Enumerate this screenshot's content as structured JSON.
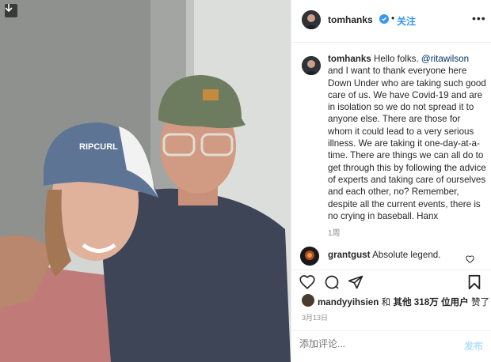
{
  "post": {
    "author": "tomhanks",
    "separator": "•",
    "follow_label": "关注",
    "more_label": "•••",
    "caption_author": "tomhanks",
    "caption_parts": {
      "before_mention": "Hello folks. ",
      "mention": "@ritawilson",
      "after_mention": " and I want to thank everyone here Down Under who are taking such good care of us. We have Covid-19 and are in isolation so we do not spread it to anyone else. There are those for whom it could lead to a very serious illness. We are taking it one-day-at-a-time. There are things we can all do to get through this by following the advice of experts and taking care of ourselves and each other, no? Remember, despite all the current events, there is no crying in baseball. Hanx"
    },
    "caption_time": "1周",
    "comment": {
      "author": "grantgust",
      "text": "Absolute legend."
    },
    "likes": {
      "user": "mandyyihsien",
      "connector": "和 ",
      "others": "其他 318万 位用户",
      "suffix": "赞了"
    },
    "date": "3月13日",
    "composer": {
      "placeholder": "添加评论...",
      "post_label": "发布"
    }
  },
  "colors": {
    "accent": "#3897f0",
    "verified": "#3897f0",
    "muted": "#8e8e8e"
  }
}
